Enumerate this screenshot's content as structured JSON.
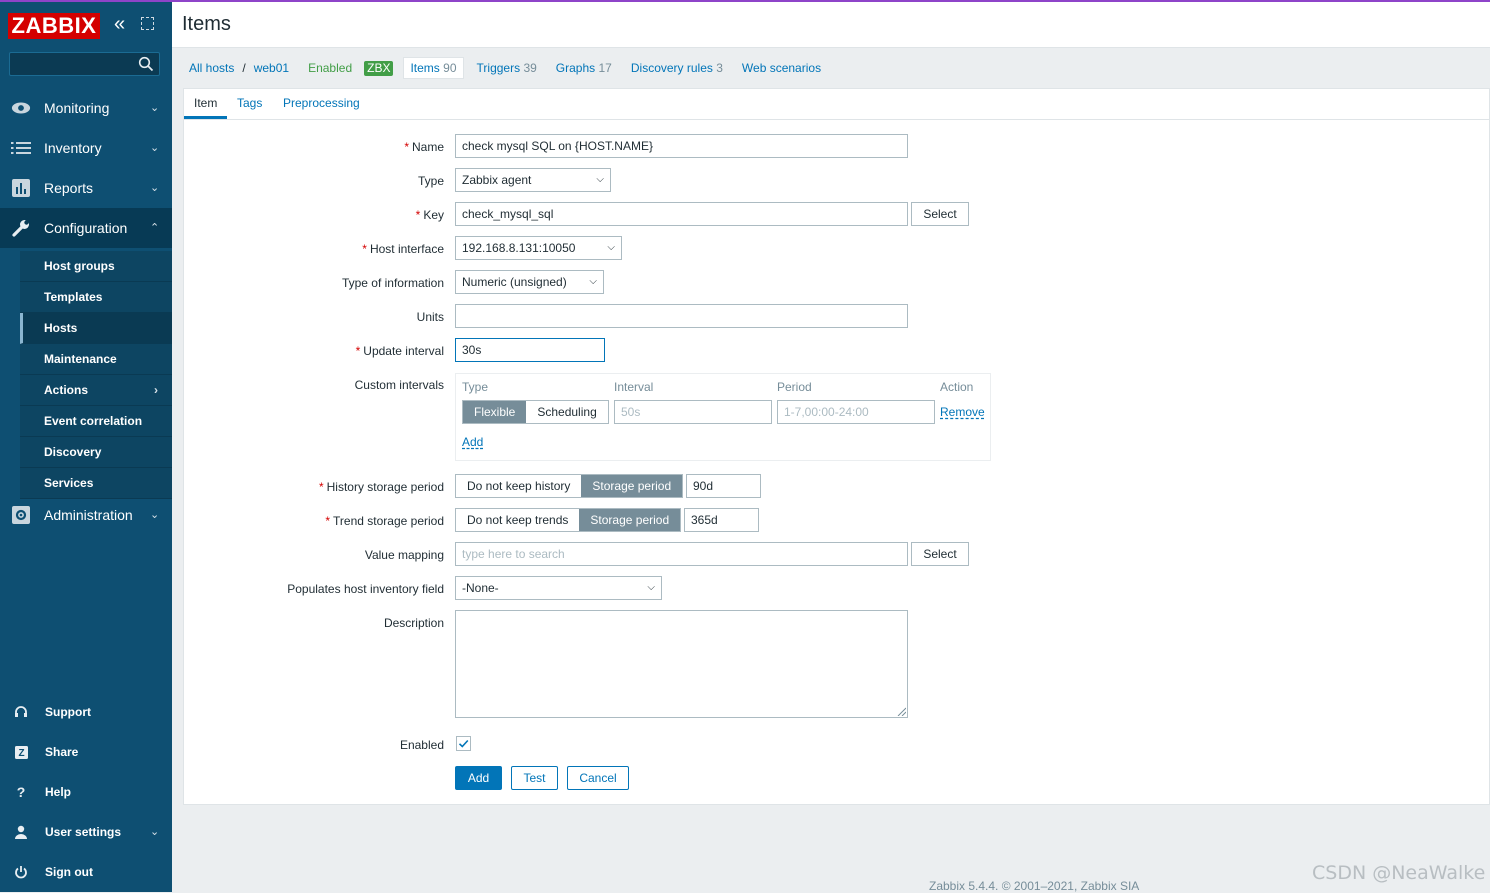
{
  "app": {
    "logo": "ZABBIX",
    "collapse_icon": "«"
  },
  "sidebar": {
    "search_placeholder": "",
    "main_items": [
      {
        "label": "Monitoring",
        "icon": "eye-icon"
      },
      {
        "label": "Inventory",
        "icon": "list-icon"
      },
      {
        "label": "Reports",
        "icon": "bar-chart-icon"
      },
      {
        "label": "Configuration",
        "icon": "wrench-icon"
      },
      {
        "label": "Administration",
        "icon": "gear-icon"
      }
    ],
    "config_sub": [
      "Host groups",
      "Templates",
      "Hosts",
      "Maintenance",
      "Actions",
      "Event correlation",
      "Discovery",
      "Services"
    ],
    "bottom_items": [
      {
        "label": "Support",
        "icon": "headset-icon"
      },
      {
        "label": "Share",
        "icon": "share-icon"
      },
      {
        "label": "Help",
        "icon": "help-icon"
      },
      {
        "label": "User settings",
        "icon": "user-icon"
      },
      {
        "label": "Sign out",
        "icon": "power-icon"
      }
    ]
  },
  "header": {
    "title": "Items"
  },
  "host_nav": {
    "all_hosts": "All hosts",
    "separator": "/",
    "host": "web01",
    "status": "Enabled",
    "zbx": "ZBX",
    "items": {
      "label": "Items",
      "count": "90"
    },
    "triggers": {
      "label": "Triggers",
      "count": "39"
    },
    "graphs": {
      "label": "Graphs",
      "count": "17"
    },
    "discovery": {
      "label": "Discovery rules",
      "count": "3"
    },
    "web": {
      "label": "Web scenarios"
    }
  },
  "tabs": [
    "Item",
    "Tags",
    "Preprocessing"
  ],
  "form": {
    "name": {
      "label": "Name",
      "value": "check mysql SQL on {HOST.NAME}"
    },
    "type": {
      "label": "Type",
      "value": "Zabbix agent"
    },
    "key": {
      "label": "Key",
      "value": "check_mysql_sql",
      "button": "Select"
    },
    "host_interface": {
      "label": "Host interface",
      "value": "192.168.8.131:10050"
    },
    "type_info": {
      "label": "Type of information",
      "value": "Numeric (unsigned)"
    },
    "units": {
      "label": "Units",
      "value": ""
    },
    "update_interval": {
      "label": "Update interval",
      "value": "30s"
    },
    "custom_intervals": {
      "label": "Custom intervals",
      "col_type": "Type",
      "col_interval": "Interval",
      "col_period": "Period",
      "col_action": "Action",
      "flexible": "Flexible",
      "scheduling": "Scheduling",
      "interval_placeholder": "50s",
      "period_placeholder": "1-7,00:00-24:00",
      "remove": "Remove",
      "add": "Add"
    },
    "history": {
      "label": "History storage period",
      "opt1": "Do not keep history",
      "opt2": "Storage period",
      "value": "90d"
    },
    "trend": {
      "label": "Trend storage period",
      "opt1": "Do not keep trends",
      "opt2": "Storage period",
      "value": "365d"
    },
    "value_mapping": {
      "label": "Value mapping",
      "placeholder": "type here to search",
      "button": "Select"
    },
    "inventory": {
      "label": "Populates host inventory field",
      "value": "-None-"
    },
    "description": {
      "label": "Description",
      "value": ""
    },
    "enabled": {
      "label": "Enabled",
      "checked": true
    },
    "buttons": {
      "add": "Add",
      "test": "Test",
      "cancel": "Cancel"
    }
  },
  "footer": "Zabbix 5.4.4. © 2001–2021, Zabbix SIA",
  "watermark": "CSDN @NeaWalke",
  "colors": {
    "sidebar": "#0e4f72",
    "accent": "#0275b8",
    "logo": "#d40000",
    "status_green": "#429e47",
    "required": "#d40000"
  }
}
